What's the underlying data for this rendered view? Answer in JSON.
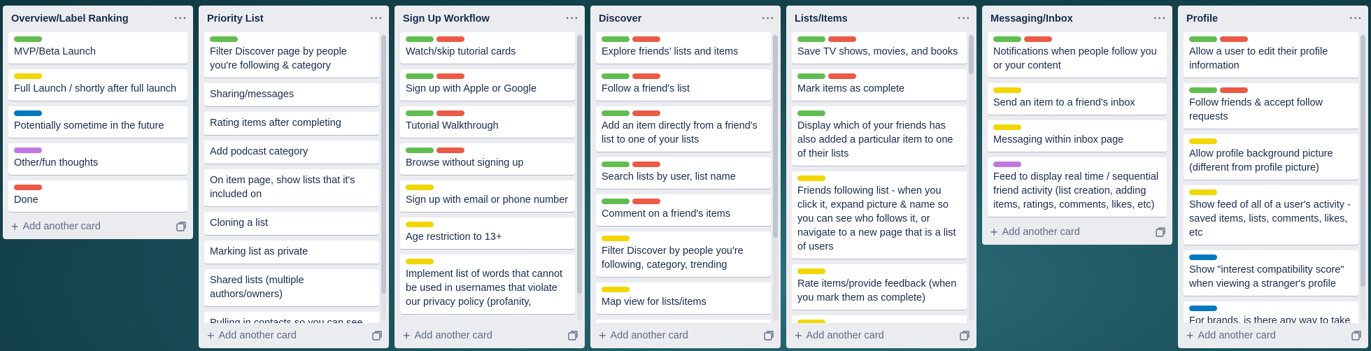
{
  "colors": {
    "green": "#61bd4f",
    "yellow": "#f2d600",
    "blue": "#0079bf",
    "purple": "#c377e0",
    "red": "#eb5a46"
  },
  "add_card_label": "Add another card",
  "lists": [
    {
      "title": "Overview/Label Ranking",
      "cards": [
        {
          "labels": [
            "green"
          ],
          "text": "MVP/Beta Launch"
        },
        {
          "labels": [
            "yellow"
          ],
          "text": "Full Launch / shortly after full launch"
        },
        {
          "labels": [
            "blue"
          ],
          "text": "Potentially sometime in the future"
        },
        {
          "labels": [
            "purple"
          ],
          "text": "Other/fun thoughts"
        },
        {
          "labels": [
            "red"
          ],
          "text": "Done"
        }
      ]
    },
    {
      "title": "Priority List",
      "cards": [
        {
          "labels": [
            "green"
          ],
          "text": "Filter Discover page by people you're following & category"
        },
        {
          "labels": [],
          "text": "Sharing/messages"
        },
        {
          "labels": [],
          "text": "Rating items after completing"
        },
        {
          "labels": [],
          "text": "Add podcast category"
        },
        {
          "labels": [],
          "text": "On item page, show lists that it's included on"
        },
        {
          "labels": [],
          "text": "Cloning a list"
        },
        {
          "labels": [],
          "text": "Marking list as private"
        },
        {
          "labels": [],
          "text": "Shared lists (multiple authors/owners)"
        },
        {
          "labels": [],
          "text": "Pulling in contacts so you can see"
        }
      ]
    },
    {
      "title": "Sign Up Workflow",
      "cards": [
        {
          "labels": [
            "green",
            "red"
          ],
          "text": "Watch/skip tutorial cards"
        },
        {
          "labels": [
            "green",
            "red"
          ],
          "text": "Sign up with Apple or Google"
        },
        {
          "labels": [
            "green",
            "red"
          ],
          "text": "Tutorial Walkthrough"
        },
        {
          "labels": [
            "green",
            "red"
          ],
          "text": "Browse without signing up"
        },
        {
          "labels": [
            "yellow"
          ],
          "text": "Sign up with email or phone number"
        },
        {
          "labels": [
            "yellow"
          ],
          "text": "Age restriction to 13+"
        },
        {
          "labels": [
            "yellow"
          ],
          "text": "Implement list of words that cannot be used in usernames that violate our privacy policy (profanity,"
        }
      ]
    },
    {
      "title": "Discover",
      "cards": [
        {
          "labels": [
            "green",
            "red"
          ],
          "text": "Explore friends' lists and items"
        },
        {
          "labels": [
            "green",
            "red"
          ],
          "text": "Follow a friend's list"
        },
        {
          "labels": [
            "green",
            "red"
          ],
          "text": "Add an item directly from a friend's list to one of your lists"
        },
        {
          "labels": [
            "green",
            "red"
          ],
          "text": "Search lists by user, list name"
        },
        {
          "labels": [
            "green",
            "red"
          ],
          "text": "Comment on a friend's items"
        },
        {
          "labels": [
            "yellow"
          ],
          "text": "Filter Discover by people you're following, category, trending"
        },
        {
          "labels": [
            "yellow"
          ],
          "text": "Map view for lists/items"
        },
        {
          "labels": [
            "blue"
          ],
          "text": ""
        }
      ]
    },
    {
      "title": "Lists/Items",
      "cards": [
        {
          "labels": [
            "green",
            "red"
          ],
          "text": "Save TV shows, movies, and books"
        },
        {
          "labels": [
            "green",
            "red"
          ],
          "text": "Mark items as complete"
        },
        {
          "labels": [
            "green"
          ],
          "text": "Display which of your friends has also added a particular item to one of their lists"
        },
        {
          "labels": [
            "yellow"
          ],
          "text": "Friends following list - when you click it, expand picture & name so you can see who follows it, or navigate to a new page that is a list of users"
        },
        {
          "labels": [
            "yellow"
          ],
          "text": "Rate items/provide feedback (when you mark them as complete)"
        },
        {
          "labels": [
            "yellow"
          ],
          "text": ""
        }
      ]
    },
    {
      "title": "Messaging/Inbox",
      "cards": [
        {
          "labels": [
            "green",
            "red"
          ],
          "text": "Notifications when people follow you or your content"
        },
        {
          "labels": [
            "yellow"
          ],
          "text": "Send an item to a friend's inbox"
        },
        {
          "labels": [
            "yellow"
          ],
          "text": "Messaging within inbox page"
        },
        {
          "labels": [
            "purple"
          ],
          "text": "Feed to display real time / sequential friend activity (list creation, adding items, ratings, comments, likes, etc)"
        }
      ]
    },
    {
      "title": "Profile",
      "cards": [
        {
          "labels": [
            "green",
            "red"
          ],
          "text": "Allow a user to edit their profile information"
        },
        {
          "labels": [
            "green",
            "red"
          ],
          "text": "Follow friends & accept follow requests"
        },
        {
          "labels": [
            "yellow"
          ],
          "text": "Allow profile background picture (different from profile picture)"
        },
        {
          "labels": [
            "yellow"
          ],
          "text": "Show feed of all of a user's activity - saved items, lists, comments, likes, etc"
        },
        {
          "labels": [
            "blue"
          ],
          "text": "Show \"interest compatibility score\" when viewing a stranger's profile"
        },
        {
          "labels": [
            "blue"
          ],
          "text": "For brands, is there any way to take"
        }
      ]
    }
  ]
}
